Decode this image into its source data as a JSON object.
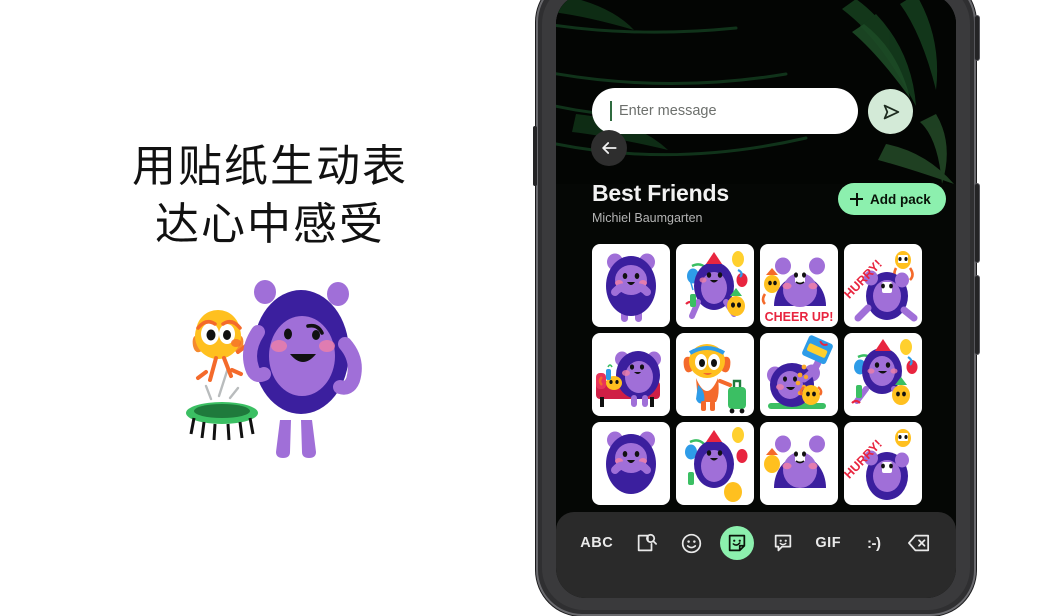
{
  "promo": {
    "headline_line1": "用贴纸生动表",
    "headline_line2": "达心中感受",
    "illustration_name": "monster-trampoline-illustration"
  },
  "phone": {
    "wallpaper_description": "dark palm leaves"
  },
  "message_bar": {
    "placeholder": "Enter message",
    "value": "",
    "send_label": "send-icon"
  },
  "navigation": {
    "back_label": "back-arrow-icon"
  },
  "sticker_pack": {
    "title": "Best Friends",
    "author": "Michiel Baumgarten",
    "add_pack_label": "Add pack",
    "add_pack_color": "#8cf0ae"
  },
  "sticker_grid": {
    "rows": [
      [
        {
          "name": "monster-shy",
          "caption": ""
        },
        {
          "name": "monster-party-balloons",
          "caption": ""
        },
        {
          "name": "monster-cheer-up",
          "caption": "CHEER UP!"
        },
        {
          "name": "monster-hurry",
          "caption": "HURRY!"
        }
      ],
      [
        {
          "name": "monster-on-couch",
          "caption": ""
        },
        {
          "name": "friend-traveler-suitcase",
          "caption": ""
        },
        {
          "name": "monster-snack-pouring",
          "caption": ""
        },
        {
          "name": "monster-party-dance",
          "caption": ""
        }
      ],
      [
        {
          "name": "monster-shy",
          "caption": ""
        },
        {
          "name": "monster-party-balloons",
          "caption": ""
        },
        {
          "name": "monster-cheer-up",
          "caption": ""
        },
        {
          "name": "monster-hurry",
          "caption": "HURRY!"
        }
      ]
    ]
  },
  "keyboard_toolbar": {
    "items": [
      {
        "name": "abc-key",
        "label": "ABC",
        "type": "text",
        "active": false
      },
      {
        "name": "image-search-icon",
        "label": "",
        "type": "icon",
        "active": false
      },
      {
        "name": "emoji-icon",
        "label": "",
        "type": "icon",
        "active": false
      },
      {
        "name": "sticker-icon",
        "label": "",
        "type": "icon",
        "active": true
      },
      {
        "name": "emoji-kitchen-icon",
        "label": "",
        "type": "icon",
        "active": false
      },
      {
        "name": "gif-key",
        "label": "GIF",
        "type": "text",
        "active": false
      },
      {
        "name": "emoticon-key",
        "label": ":-)",
        "type": "text",
        "active": false
      },
      {
        "name": "backspace-icon",
        "label": "",
        "type": "icon",
        "active": false
      }
    ]
  },
  "colors": {
    "accent_green": "#8cf0ae",
    "send_green": "#d3ead7",
    "panel_dark": "#2a2a2a",
    "monster_purple": "#3b1f9e",
    "monster_light": "#a06fd8",
    "friend_yellow": "#ffc01f",
    "friend_orange": "#f46a2b",
    "red_text": "#e8253f"
  }
}
